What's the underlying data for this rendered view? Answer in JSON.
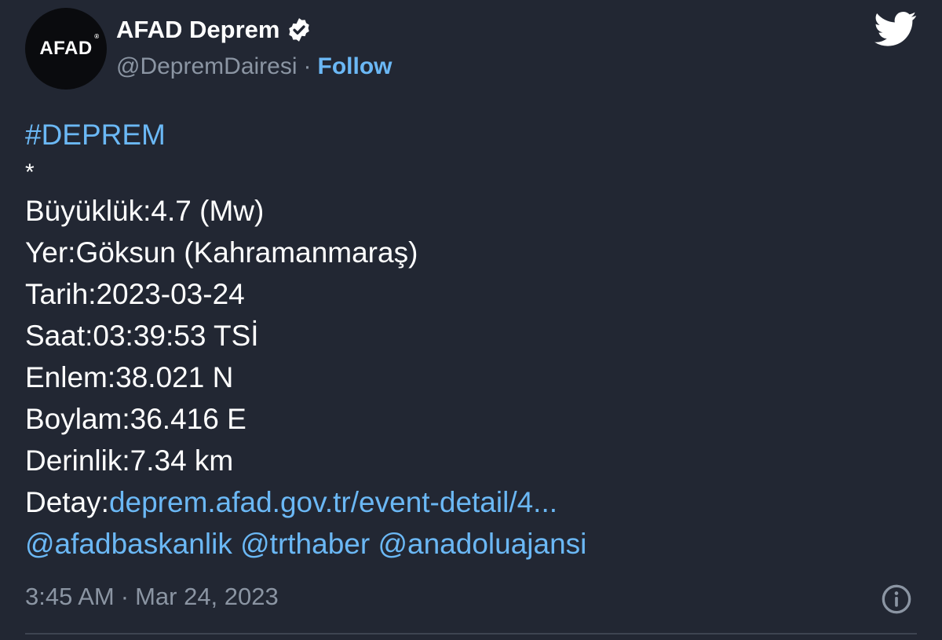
{
  "author": {
    "avatar_text": "AFAD",
    "avatar_mark": "®",
    "display_name": "AFAD Deprem",
    "verified_icon": "verified-badge-icon",
    "handle": "@DepremDairesi",
    "separator": "·",
    "follow_label": "Follow"
  },
  "brand_icon": "twitter-bird-icon",
  "tweet": {
    "hashtag": "#DEPREM",
    "star": "*",
    "magnitude": "Büyüklük:4.7 (Mw)",
    "location": "Yer:Göksun (Kahramanmaraş)",
    "date": "Tarih:2023-03-24",
    "time": "Saat:03:39:53 TSİ",
    "latitude": "Enlem:38.021 N",
    "longitude": "Boylam:36.416 E",
    "depth": "Derinlik:7.34 km",
    "detail_label": "Detay:",
    "detail_link": "deprem.afad.gov.tr/event-detail/4...",
    "mentions": [
      "@afadbaskanlik",
      "@trthaber",
      "@anadoluajansi"
    ]
  },
  "footer": {
    "time": "3:45 AM",
    "separator": "·",
    "date": "Mar 24, 2023",
    "info_icon": "info-icon"
  },
  "colors": {
    "background": "#222733",
    "link": "#6bb8f5",
    "muted": "#8b95a3",
    "text": "#ffffff"
  }
}
